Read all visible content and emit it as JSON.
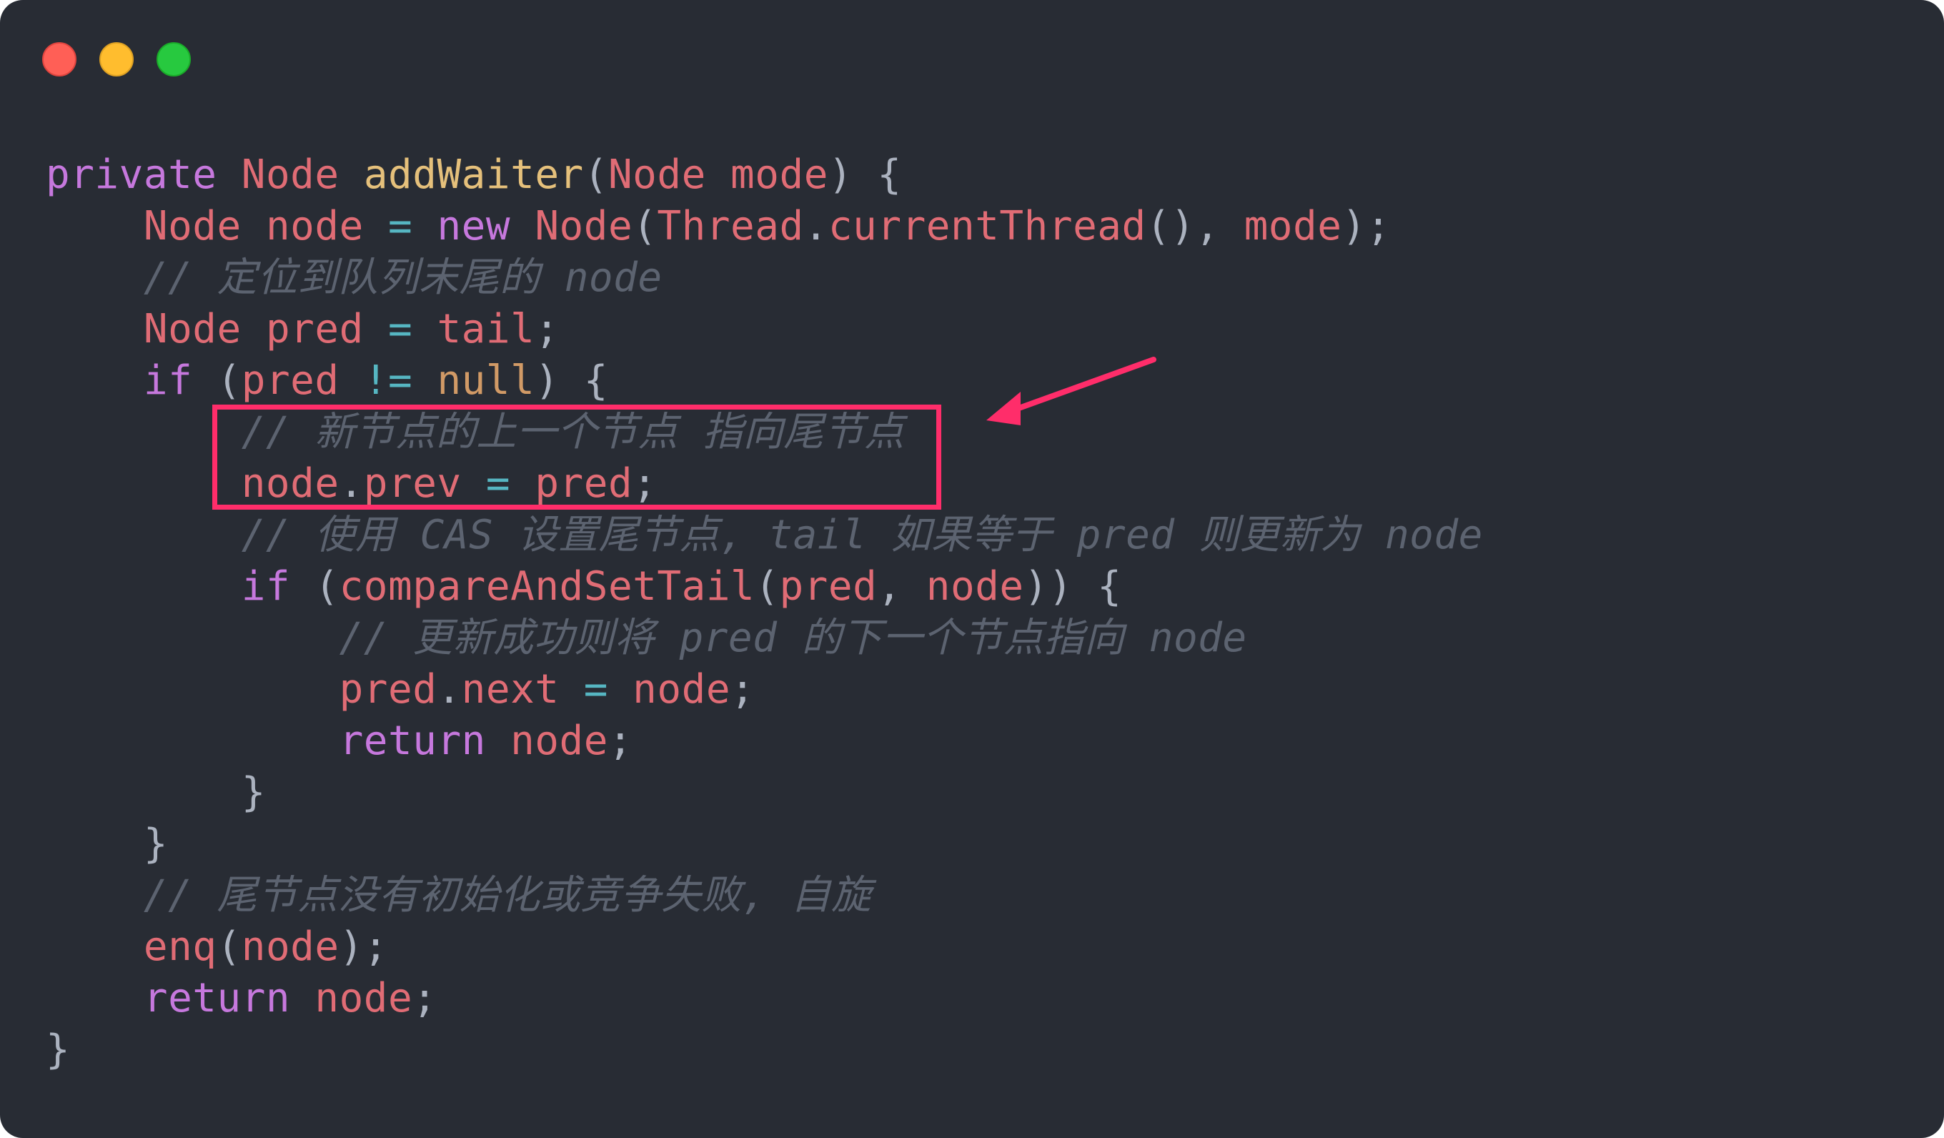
{
  "window": {
    "controls": [
      {
        "name": "close",
        "color": "#ff5f56"
      },
      {
        "name": "minimize",
        "color": "#ffbd2e"
      },
      {
        "name": "maximize",
        "color": "#27c93f"
      }
    ]
  },
  "highlight": {
    "color": "#ff2d6a"
  },
  "code": {
    "lines": [
      [
        [
          "private",
          "kw"
        ],
        [
          " ",
          "p"
        ],
        [
          "Node",
          "ty"
        ],
        [
          " ",
          "p"
        ],
        [
          "addWaiter",
          "fn"
        ],
        [
          "(",
          "p"
        ],
        [
          "Node",
          "ty"
        ],
        [
          " ",
          "p"
        ],
        [
          "mode",
          "ty"
        ],
        [
          ") {",
          "p"
        ]
      ],
      [
        [
          "    ",
          "p"
        ],
        [
          "Node",
          "ty"
        ],
        [
          " ",
          "p"
        ],
        [
          "node",
          "ty"
        ],
        [
          " ",
          "p"
        ],
        [
          "=",
          "op"
        ],
        [
          " ",
          "p"
        ],
        [
          "new",
          "kw"
        ],
        [
          " ",
          "p"
        ],
        [
          "Node",
          "ty"
        ],
        [
          "(",
          "p"
        ],
        [
          "Thread",
          "ty"
        ],
        [
          ".",
          "p"
        ],
        [
          "currentThread",
          "ty"
        ],
        [
          "(), ",
          "p"
        ],
        [
          "mode",
          "ty"
        ],
        [
          ");",
          "p"
        ]
      ],
      [
        [
          "    ",
          "p"
        ],
        [
          "// 定位到队列末尾的 node",
          "cm"
        ]
      ],
      [
        [
          "    ",
          "p"
        ],
        [
          "Node",
          "ty"
        ],
        [
          " ",
          "p"
        ],
        [
          "pred",
          "ty"
        ],
        [
          " ",
          "p"
        ],
        [
          "=",
          "op"
        ],
        [
          " ",
          "p"
        ],
        [
          "tail",
          "ty"
        ],
        [
          ";",
          "p"
        ]
      ],
      [
        [
          "    ",
          "p"
        ],
        [
          "if",
          "kw"
        ],
        [
          " (",
          "p"
        ],
        [
          "pred",
          "ty"
        ],
        [
          " ",
          "p"
        ],
        [
          "!=",
          "op"
        ],
        [
          " ",
          "p"
        ],
        [
          "null",
          "lit"
        ],
        [
          ") {",
          "p"
        ]
      ],
      [
        [
          "        ",
          "p"
        ],
        [
          "// 新节点的上一个节点 指向尾节点",
          "cm"
        ]
      ],
      [
        [
          "        ",
          "p"
        ],
        [
          "node",
          "ty"
        ],
        [
          ".",
          "p"
        ],
        [
          "prev",
          "ty"
        ],
        [
          " ",
          "p"
        ],
        [
          "=",
          "op"
        ],
        [
          " ",
          "p"
        ],
        [
          "pred",
          "ty"
        ],
        [
          ";",
          "p"
        ]
      ],
      [
        [
          "        ",
          "p"
        ],
        [
          "// 使用 CAS 设置尾节点, tail 如果等于 pred 则更新为 node",
          "cm"
        ]
      ],
      [
        [
          "        ",
          "p"
        ],
        [
          "if",
          "kw"
        ],
        [
          " (",
          "p"
        ],
        [
          "compareAndSetTail",
          "ty"
        ],
        [
          "(",
          "p"
        ],
        [
          "pred",
          "ty"
        ],
        [
          ", ",
          "p"
        ],
        [
          "node",
          "ty"
        ],
        [
          ")) {",
          "p"
        ]
      ],
      [
        [
          "            ",
          "p"
        ],
        [
          "// 更新成功则将 pred 的下一个节点指向 node",
          "cm"
        ]
      ],
      [
        [
          "            ",
          "p"
        ],
        [
          "pred",
          "ty"
        ],
        [
          ".",
          "p"
        ],
        [
          "next",
          "ty"
        ],
        [
          " ",
          "p"
        ],
        [
          "=",
          "op"
        ],
        [
          " ",
          "p"
        ],
        [
          "node",
          "ty"
        ],
        [
          ";",
          "p"
        ]
      ],
      [
        [
          "            ",
          "p"
        ],
        [
          "return",
          "kw"
        ],
        [
          " ",
          "p"
        ],
        [
          "node",
          "ty"
        ],
        [
          ";",
          "p"
        ]
      ],
      [
        [
          "        }",
          "p"
        ]
      ],
      [
        [
          "    }",
          "p"
        ]
      ],
      [
        [
          "    ",
          "p"
        ],
        [
          "// 尾节点没有初始化或竞争失败, 自旋",
          "cm"
        ]
      ],
      [
        [
          "    ",
          "p"
        ],
        [
          "enq",
          "ty"
        ],
        [
          "(",
          "p"
        ],
        [
          "node",
          "ty"
        ],
        [
          ");",
          "p"
        ]
      ],
      [
        [
          "    ",
          "p"
        ],
        [
          "return",
          "kw"
        ],
        [
          " ",
          "p"
        ],
        [
          "node",
          "ty"
        ],
        [
          ";",
          "p"
        ]
      ],
      [
        [
          "}",
          "p"
        ]
      ]
    ]
  }
}
